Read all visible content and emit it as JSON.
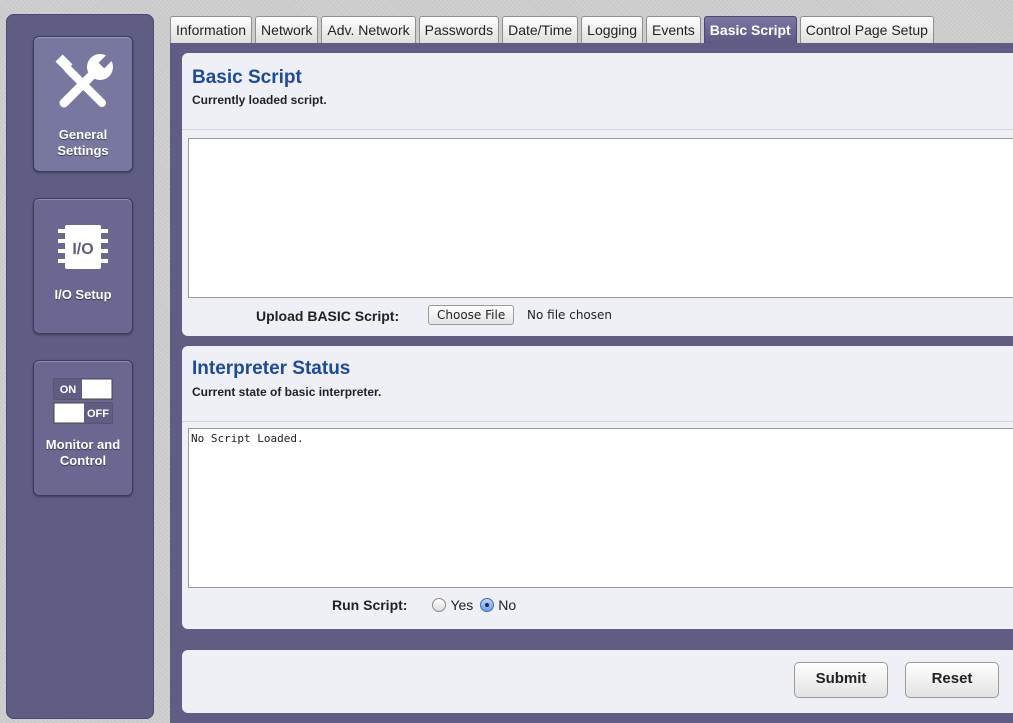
{
  "sidebar": {
    "items": [
      {
        "label_line1": "General",
        "label_line2": "Settings",
        "icon": "wrench-screwdriver-icon"
      },
      {
        "label_line1": "I/O Setup",
        "label_line2": "",
        "icon": "io-chip-icon",
        "icon_text": "I/O"
      },
      {
        "label_line1": "Monitor and",
        "label_line2": "Control",
        "icon": "on-off-switch-icon",
        "switch_on": "ON",
        "switch_off": "OFF"
      }
    ]
  },
  "tabs": [
    "Information",
    "Network",
    "Adv. Network",
    "Passwords",
    "Date/Time",
    "Logging",
    "Events",
    "Basic Script",
    "Control Page Setup"
  ],
  "active_tab": "Basic Script",
  "basic_script": {
    "title": "Basic Script",
    "subtitle": "Currently loaded script.",
    "textarea_value": "",
    "upload_label": "Upload BASIC Script:",
    "choose_file_label": "Choose File",
    "file_status": "No file chosen"
  },
  "interpreter": {
    "title": "Interpreter Status",
    "subtitle": "Current state of basic interpreter.",
    "status_text": "No Script Loaded.",
    "run_label": "Run Script:",
    "options": [
      {
        "label": "Yes",
        "checked": false
      },
      {
        "label": "No",
        "checked": true
      }
    ]
  },
  "actions": {
    "submit_label": "Submit",
    "reset_label": "Reset"
  },
  "colors": {
    "sidebar": "#5f5d84",
    "panel": "#eef0f5",
    "title": "#1d4aa0",
    "active_tab": "#6b6993"
  }
}
